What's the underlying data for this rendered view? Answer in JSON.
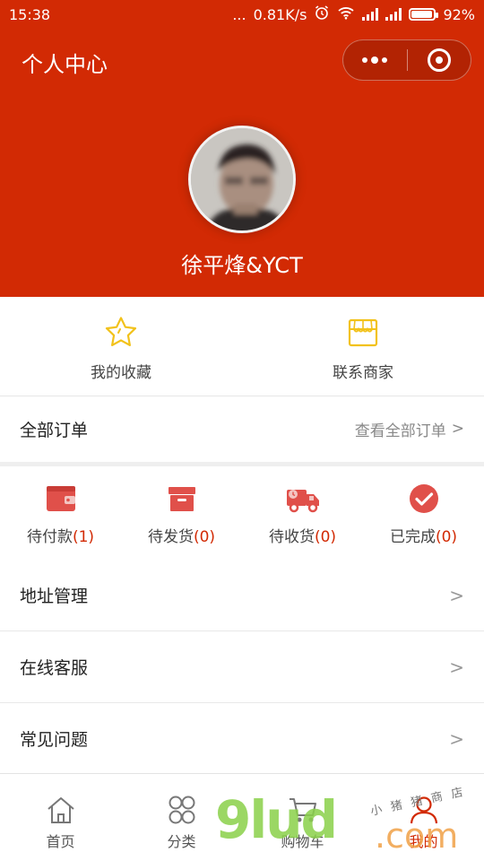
{
  "status_bar": {
    "time": "15:38",
    "speed": "0.81K/s",
    "dots": "...",
    "battery": "92%",
    "battery_level": 0.92
  },
  "header": {
    "title": "个人中心",
    "username": "徐平烽&YCT",
    "background_color": "#d22a04"
  },
  "quick_actions": [
    {
      "label": "我的收藏",
      "icon": "star-icon"
    },
    {
      "label": "联系商家",
      "icon": "shop-icon"
    }
  ],
  "orders": {
    "title": "全部订单",
    "view_all": "查看全部订单",
    "chevron": ">"
  },
  "order_status": [
    {
      "label": "待付款",
      "count": "(1)",
      "icon": "wallet-icon"
    },
    {
      "label": "待发货",
      "count": "(0)",
      "icon": "box-icon"
    },
    {
      "label": "待收货",
      "count": "(0)",
      "icon": "truck-icon"
    },
    {
      "label": "已完成",
      "count": "(0)",
      "icon": "check-circle-icon"
    }
  ],
  "menu": [
    {
      "label": "地址管理",
      "chevron": ">"
    },
    {
      "label": "在线客服",
      "chevron": ">"
    },
    {
      "label": "常见问题",
      "chevron": ">"
    }
  ],
  "tabs": [
    {
      "label": "首页",
      "icon": "home-icon"
    },
    {
      "label": "分类",
      "icon": "grid-icon"
    },
    {
      "label": "购物车",
      "icon": "cart-icon"
    },
    {
      "label": "我的",
      "icon": "user-icon",
      "active": true
    }
  ],
  "watermark": {
    "main": "9lud",
    "suffix": ".com",
    "chinese": "小猪猪商店"
  },
  "colors": {
    "accent": "#d22a04",
    "icon_red": "#e0504a",
    "star_yellow": "#f2c21b"
  }
}
